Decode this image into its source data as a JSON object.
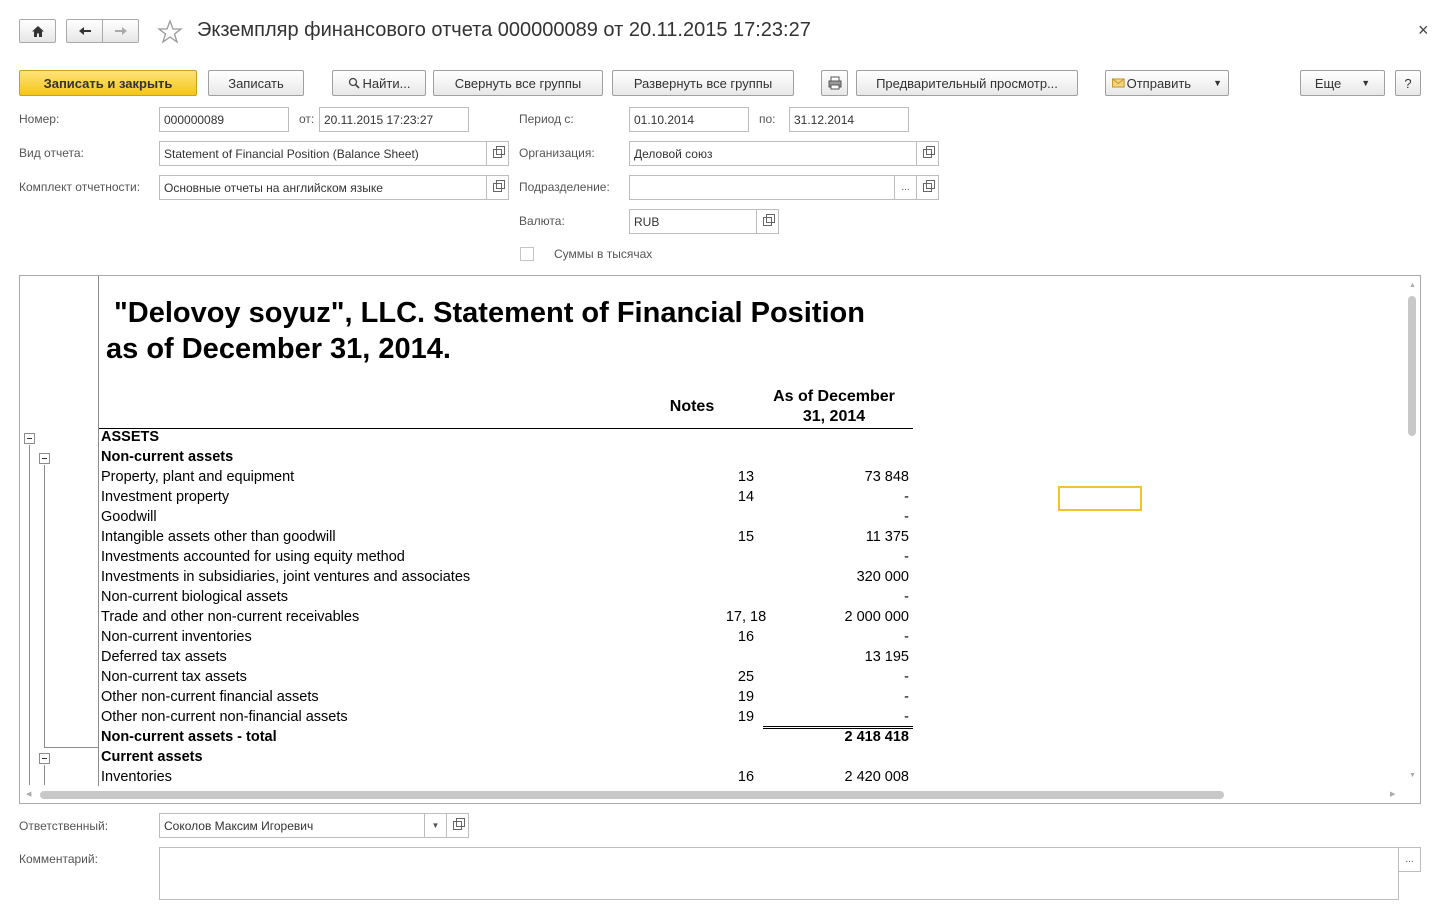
{
  "window": {
    "title": "Экземпляр финансового отчета 000000089 от 20.11.2015 17:23:27",
    "close_glyph": "×"
  },
  "toolbar": {
    "save_close": "Записать и закрыть",
    "save": "Записать",
    "find": "Найти...",
    "collapse_all": "Свернуть все группы",
    "expand_all": "Развернуть все группы",
    "preview": "Предварительный просмотр...",
    "send": "Отправить",
    "more": "Еще",
    "help": "?"
  },
  "form": {
    "number_label": "Номер:",
    "number_value": "000000089",
    "from_label": "от:",
    "from_value": "20.11.2015 17:23:27",
    "period_label": "Период с:",
    "period_from": "01.10.2014",
    "period_to_label": "по:",
    "period_to": "31.12.2014",
    "report_type_label": "Вид отчета:",
    "report_type_value": "Statement of Financial Position (Balance Sheet)",
    "organization_label": "Организация:",
    "organization_value": "Деловой союз",
    "reporting_set_label": "Комплект отчетности:",
    "reporting_set_value": "Основные отчеты на английском языке",
    "division_label": "Подразделение:",
    "division_value": "",
    "currency_label": "Валюта:",
    "currency_value": "RUB",
    "thousands_label": "Суммы в тысячах",
    "responsible_label": "Ответственный:",
    "responsible_value": "Соколов Максим Игоревич",
    "comment_label": "Комментарий:",
    "ellipsis": "..."
  },
  "report": {
    "title_line1": "\"Delovoy soyuz\", LLC. Statement of Financial Position",
    "title_line2": "as of December 31, 2014.",
    "col_notes": "Notes",
    "col_value_line1": "As of December",
    "col_value_line2": "31, 2014",
    "rows": [
      {
        "label": "ASSETS",
        "note": "",
        "value": ""
      },
      {
        "label": "Non-current assets",
        "note": "",
        "value": ""
      },
      {
        "label": "Property, plant and equipment",
        "note": "13",
        "value": "73 848"
      },
      {
        "label": "Investment property",
        "note": "14",
        "value": "-"
      },
      {
        "label": "Goodwill",
        "note": "",
        "value": "-"
      },
      {
        "label": "Intangible assets other than goodwill",
        "note": "15",
        "value": "11 375"
      },
      {
        "label": "Investments accounted for using equity method",
        "note": "",
        "value": "-"
      },
      {
        "label": "Investments in subsidiaries, joint ventures and associates",
        "note": "",
        "value": "320 000"
      },
      {
        "label": "Non-current biological assets",
        "note": "",
        "value": "-"
      },
      {
        "label": "Trade and other non-current receivables",
        "note": "17, 18",
        "value": "2 000 000"
      },
      {
        "label": "Non-current inventories",
        "note": "16",
        "value": "-"
      },
      {
        "label": "Deferred tax assets",
        "note": "",
        "value": "13 195"
      },
      {
        "label": "Non-current tax assets",
        "note": "25",
        "value": "-"
      },
      {
        "label": "Other non-current financial assets",
        "note": "19",
        "value": "-"
      },
      {
        "label": "Other non-current non-financial assets",
        "note": "19",
        "value": "-"
      },
      {
        "label": "Non-current assets - total",
        "note": "",
        "value": "2 418 418"
      },
      {
        "label": "Current assets",
        "note": "",
        "value": ""
      },
      {
        "label": "Inventories",
        "note": "16",
        "value": "2 420 008"
      }
    ]
  },
  "icons": {
    "home": "home-icon",
    "back": "arrow-left-icon",
    "forward": "arrow-right-icon",
    "favorite": "star-icon",
    "search": "magnifier-icon",
    "print": "printer-icon",
    "send": "envelope-icon"
  },
  "colors": {
    "primary_button": "#f5c518",
    "selection_border": "#f0c52a"
  }
}
